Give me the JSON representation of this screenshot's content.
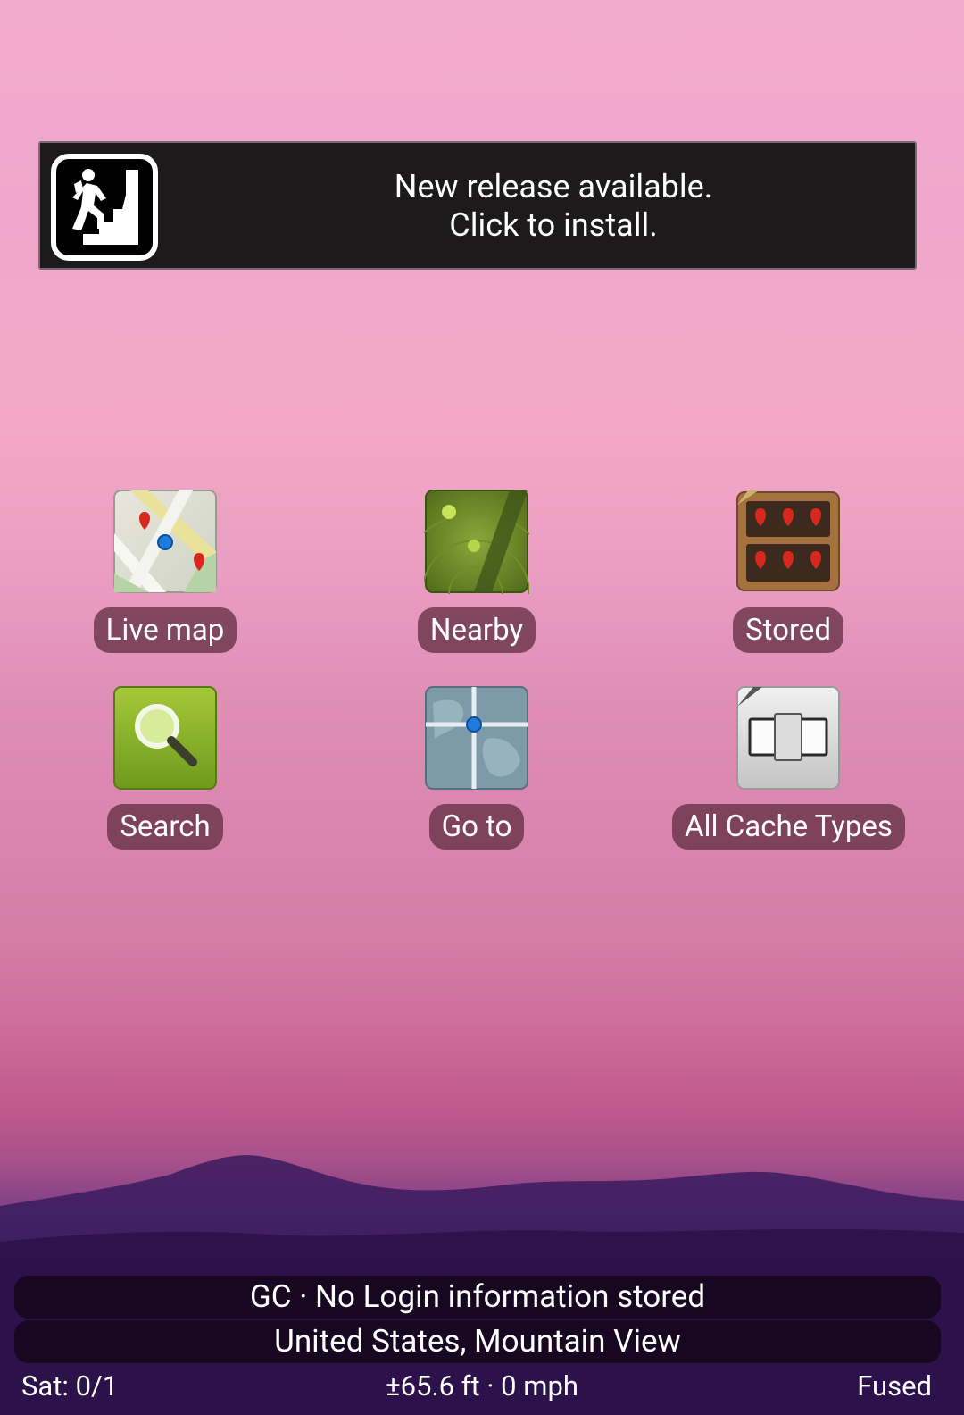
{
  "banner": {
    "line1": "New release available.",
    "line2": "Click to install.",
    "icon": "hiker-logo-icon"
  },
  "tiles": [
    {
      "label": "Live map",
      "icon": "live-map-icon"
    },
    {
      "label": "Nearby",
      "icon": "radar-icon"
    },
    {
      "label": "Stored",
      "icon": "stored-shelf-icon"
    },
    {
      "label": "Search",
      "icon": "search-magnifier-icon"
    },
    {
      "label": "Go to",
      "icon": "globe-crosshair-icon"
    },
    {
      "label": "All Cache Types",
      "icon": "cache-types-icon"
    }
  ],
  "status": {
    "login": "GC · No Login information stored",
    "location": "United States, Mountain View"
  },
  "gps": {
    "satellites": "Sat: 0/1",
    "accuracy_speed": "±65.6 ft · 0 mph",
    "provider": "Fused"
  },
  "colors": {
    "sky_top": "#f2aacd",
    "sky_mid": "#d884ac",
    "mountain": "#2a1140",
    "label_bg": "#5a283c",
    "banner_bg": "#1c1a1b"
  }
}
